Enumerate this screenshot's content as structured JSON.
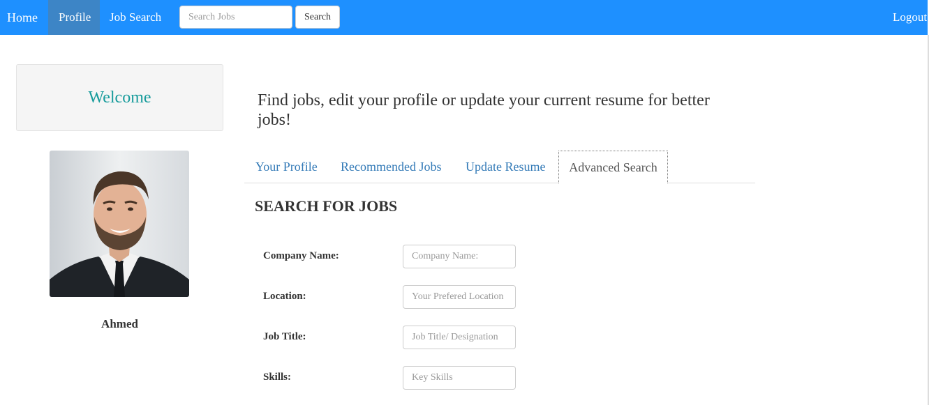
{
  "navbar": {
    "home": "Home",
    "profile": "Profile",
    "job_search": "Job Search",
    "search_placeholder": "Search Jobs",
    "search_button": "Search",
    "logout": "Logout",
    "bg_color": "#1e90ff",
    "active_color": "#3d85c6"
  },
  "sidebar": {
    "welcome": "Welcome",
    "user_name": "Ahmed",
    "avatar_icon": "user-avatar-photo"
  },
  "main": {
    "intro": "Find jobs, edit your profile or update your current resume for better jobs!",
    "tabs": [
      {
        "label": "Your Profile",
        "active": false
      },
      {
        "label": "Recommended Jobs",
        "active": false
      },
      {
        "label": "Update Resume",
        "active": false
      },
      {
        "label": "Advanced Search",
        "active": true
      }
    ],
    "section_title": "SEARCH FOR JOBS",
    "form": {
      "company": {
        "label": "Company Name:",
        "placeholder": "Company Name:"
      },
      "location": {
        "label": "Location:",
        "placeholder": "Your Prefered Location"
      },
      "job_title": {
        "label": "Job Title:",
        "placeholder": "Job Title/ Designation"
      },
      "skills": {
        "label": "Skills:",
        "placeholder": "Key Skills"
      }
    }
  }
}
